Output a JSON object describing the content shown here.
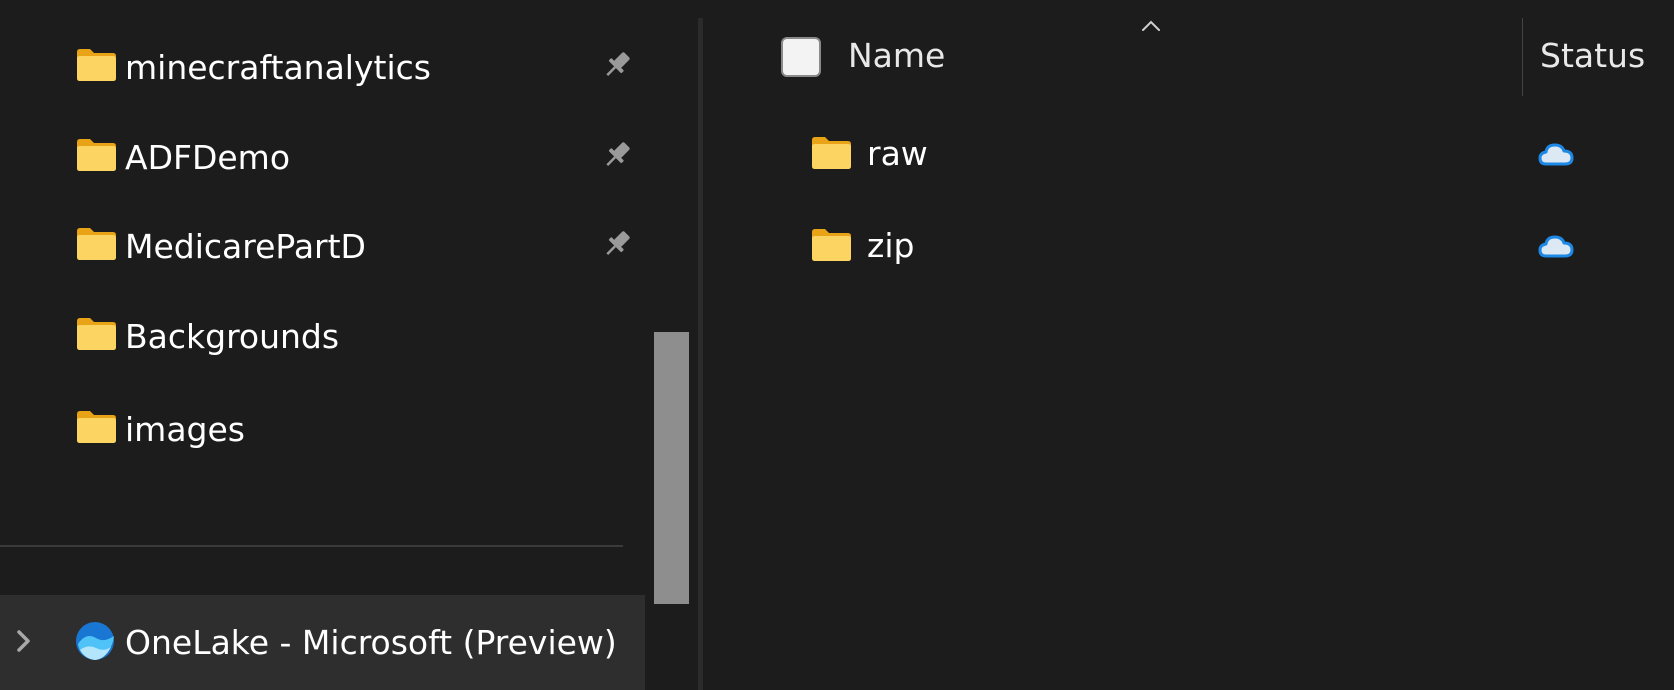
{
  "nav": {
    "items": [
      {
        "label": "minecraftanalytics",
        "icon": "folder-icon",
        "pinned": true
      },
      {
        "label": "ADFDemo",
        "icon": "folder-icon",
        "pinned": true
      },
      {
        "label": "MedicarePartD",
        "icon": "folder-icon",
        "pinned": true
      },
      {
        "label": "Backgrounds",
        "icon": "folder-icon",
        "pinned": false
      },
      {
        "label": "images",
        "icon": "folder-icon",
        "pinned": false
      }
    ],
    "onelake": {
      "label": "OneLake - Microsoft (Preview)",
      "icon": "onelake-icon",
      "expander_icon": "chevron-right-icon"
    }
  },
  "content": {
    "columns": {
      "name": "Name",
      "status": "Status"
    },
    "sort_icon": "chevron-up-icon",
    "rows": [
      {
        "name": "raw",
        "icon": "folder-icon",
        "status_icon": "cloud-icon"
      },
      {
        "name": "zip",
        "icon": "folder-icon",
        "status_icon": "cloud-icon"
      }
    ]
  },
  "colors": {
    "background": "#1c1c1c",
    "selected_nav": "#2e2e2e",
    "folder_yellow": "#f6c344",
    "cloud_blue": "#1e88e5",
    "scrollbar": "#8e8e8e"
  }
}
